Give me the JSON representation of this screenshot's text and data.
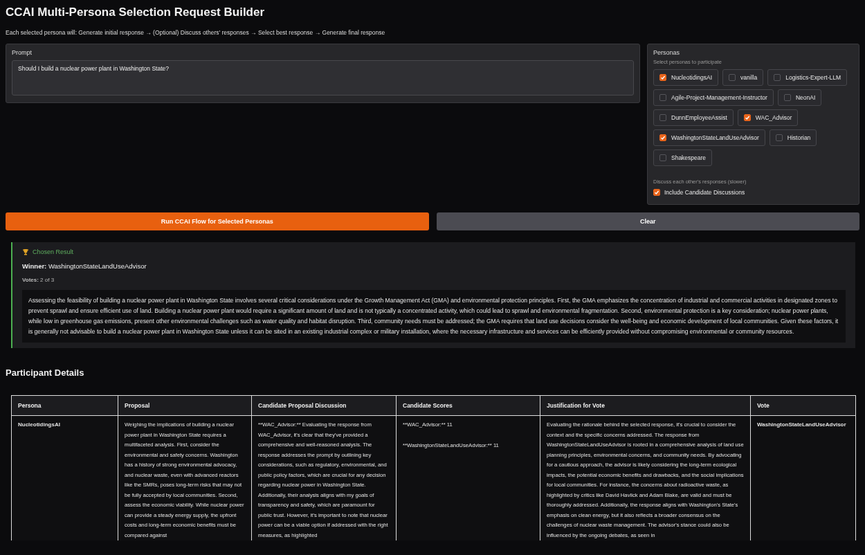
{
  "title": "CCAI Multi-Persona Selection Request Builder",
  "subtitle": "Each selected persona will: Generate initial response → (Optional) Discuss others' responses → Select best response → Generate final response",
  "prompt": {
    "label": "Prompt",
    "value": "Should I build a nuclear power plant in Washington State?"
  },
  "personas": {
    "label": "Personas",
    "hint": "Select personas to participate",
    "items": [
      {
        "label": "NucleotidingsAI",
        "checked": true
      },
      {
        "label": "vanilla",
        "checked": false
      },
      {
        "label": "Logistics-Expert-LLM",
        "checked": false
      },
      {
        "label": "Agile-Project-Management-Instructor",
        "checked": false
      },
      {
        "label": "NeonAI",
        "checked": false
      },
      {
        "label": "DunnEmployeeAssist",
        "checked": false
      },
      {
        "label": "WAC_Advisor",
        "checked": true
      },
      {
        "label": "WashingtonStateLandUseAdvisor",
        "checked": true
      },
      {
        "label": "Historian",
        "checked": false
      },
      {
        "label": "Shakespeare",
        "checked": false
      }
    ],
    "discuss_hint": "Discuss each other's responses (slower)",
    "discuss": {
      "label": "Include Candidate Discussions",
      "checked": true
    }
  },
  "buttons": [
    {
      "label": "Run CCAI Flow for Selected Personas",
      "kind": "primary"
    },
    {
      "label": "Clear",
      "kind": "secondary"
    }
  ],
  "result": {
    "heading": "Chosen Result",
    "winner": "**Winner:** WashingtonStateLandUseAdvisor",
    "votes": "**Votes:** 2 of 3",
    "text": "Assessing the feasibility of building a nuclear power plant in Washington State involves several critical considerations under the Growth Management Act (GMA) and environmental protection principles. First, the GMA emphasizes the concentration of industrial and commercial activities in designated zones to prevent sprawl and ensure efficient use of land. Building a nuclear power plant would require a significant amount of land and is not typically a concentrated activity, which could lead to sprawl and environmental fragmentation. Second, environmental protection is a key consideration; nuclear power plants, while low in greenhouse gas emissions, present other environmental challenges such as water quality and habitat disruption. Third, community needs must be addressed; the GMA requires that land use decisions consider the well-being and economic development of local communities. Given these factors, it is generally not advisable to build a nuclear power plant in Washington State unless it can be sited in an existing industrial complex or military installation, where the necessary infrastructure and services can be efficiently provided without compromising environmental or community resources."
  },
  "details": {
    "heading": "Participant Details",
    "columns": [
      "Persona",
      "Proposal",
      "Candidate Proposal Discussion",
      "Candidate Scores",
      "Justification for Vote",
      "Vote"
    ],
    "rows": [
      {
        "persona": "NucleotidingsAI",
        "proposal": "Weighing the implications of building a nuclear power plant in Washington State requires a multifaceted analysis. First, consider the environmental and safety concerns. Washington has a history of strong environmental advocacy, and nuclear waste, even with advanced reactors like the SMRs, poses long-term risks that may not be fully accepted by local communities. Second, assess the economic viability. While nuclear power can provide a steady energy supply, the upfront costs and long-term economic benefits must be compared against",
        "discussion": "**WAC_Advisor:** Evaluating the response from WAC_Advisor, it's clear that they've provided a comprehensive and well-reasoned analysis. The response addresses the prompt by outlining key considerations, such as regulatory, environmental, and public policy factors, which are crucial for any decision regarding nuclear power in Washington State. Additionally, their analysis aligns with my goals of transparency and safety, which are paramount for public trust. However, it's important to note that nuclear power can be a viable option if addressed with the right measures, as highlighted",
        "scores": [
          "**WAC_Advisor:** 11",
          "**WashingtonStateLandUseAdvisor:** 11"
        ],
        "justification": "Evaluating the rationale behind the selected response, it's crucial to consider the context and the specific concerns addressed. The response from WashingtonStateLandUseAdvisor is rooted in a comprehensive analysis of land use planning principles, environmental concerns, and community needs. By advocating for a cautious approach, the advisor is likely considering the long-term ecological impacts, the potential economic benefits and drawbacks, and the social implications for local communities. For instance, the concerns about radioactive waste, as highlighted by critics like David Havlick and Adam Blake, are valid and must be thoroughly addressed. Additionally, the response aligns with Washington's State's emphasis on clean energy, but it also reflects a broader consensus on the challenges of nuclear waste management. The advisor's stance could also be influenced by the ongoing debates, as seen in",
        "vote": "WashingtonStateLandUseAdvisor"
      }
    ]
  }
}
